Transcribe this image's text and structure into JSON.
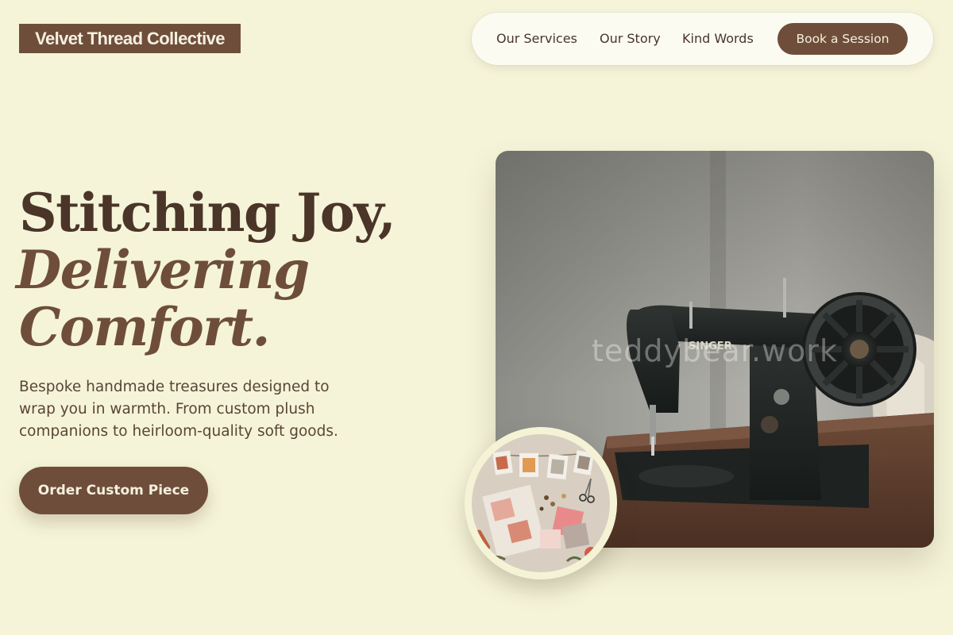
{
  "brand": {
    "logo_text": "Velvet Thread Collective"
  },
  "nav": {
    "links": [
      {
        "label": "Our Services"
      },
      {
        "label": "Our Story"
      },
      {
        "label": "Kind Words"
      }
    ],
    "cta_label": "Book a Session"
  },
  "hero": {
    "headline_line1": "Stitching Joy,",
    "headline_line2": "Delivering",
    "headline_line3": "Comfort.",
    "subcopy": "Bespoke handmade treasures designed to wrap you in warmth. From custom plush companions to heirloom-quality soft goods.",
    "cta_label": "Order Custom Piece",
    "image_watermark": "teddybear.work",
    "machine_brand": "SINGER"
  },
  "colors": {
    "background": "#f5f4d9",
    "brand_brown": "#6e4e3a",
    "text_dark": "#4a3528",
    "nav_bg": "#fbfbf2"
  },
  "icons": {
    "hero_image": "sewing-machine-photo",
    "inset_image": "craft-flatlay-photo"
  }
}
